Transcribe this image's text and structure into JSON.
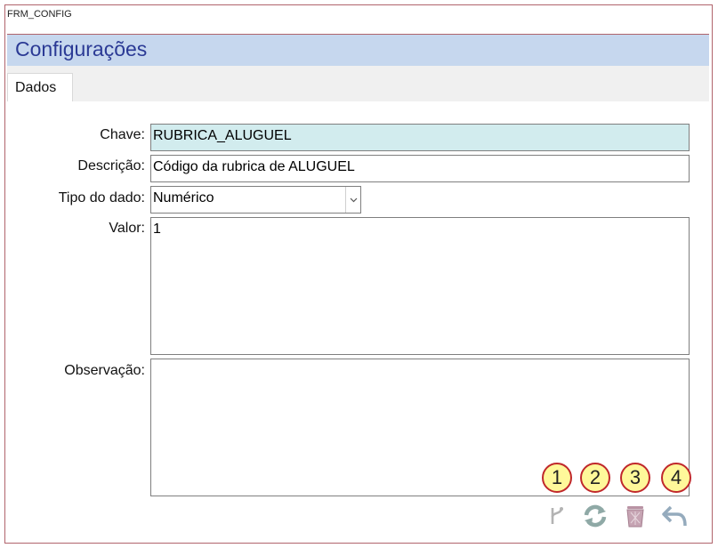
{
  "window": {
    "title": "FRM_CONFIG"
  },
  "header": {
    "title": "Configurações"
  },
  "tabs": [
    {
      "label": "Dados"
    }
  ],
  "form": {
    "chave": {
      "label": "Chave:",
      "value": "RUBRICA_ALUGUEL"
    },
    "descricao": {
      "label": "Descrição:",
      "value": "Código da rubrica de ALUGUEL"
    },
    "tipo": {
      "label": "Tipo do dado:",
      "value": "Numérico"
    },
    "valor": {
      "label": "Valor:",
      "value": "1"
    },
    "observacao": {
      "label": "Observação:",
      "value": ""
    }
  },
  "badges": [
    "1",
    "2",
    "3",
    "4"
  ],
  "toolbar": {
    "icons": [
      "branch-icon",
      "refresh-icon",
      "trash-icon",
      "undo-icon"
    ]
  },
  "colors": {
    "title_band": "#c6d7ee",
    "title_text": "#2b3a95",
    "key_field": "#d2ecee",
    "badge_fill": "#fff89a",
    "badge_border": "#c0282b"
  }
}
